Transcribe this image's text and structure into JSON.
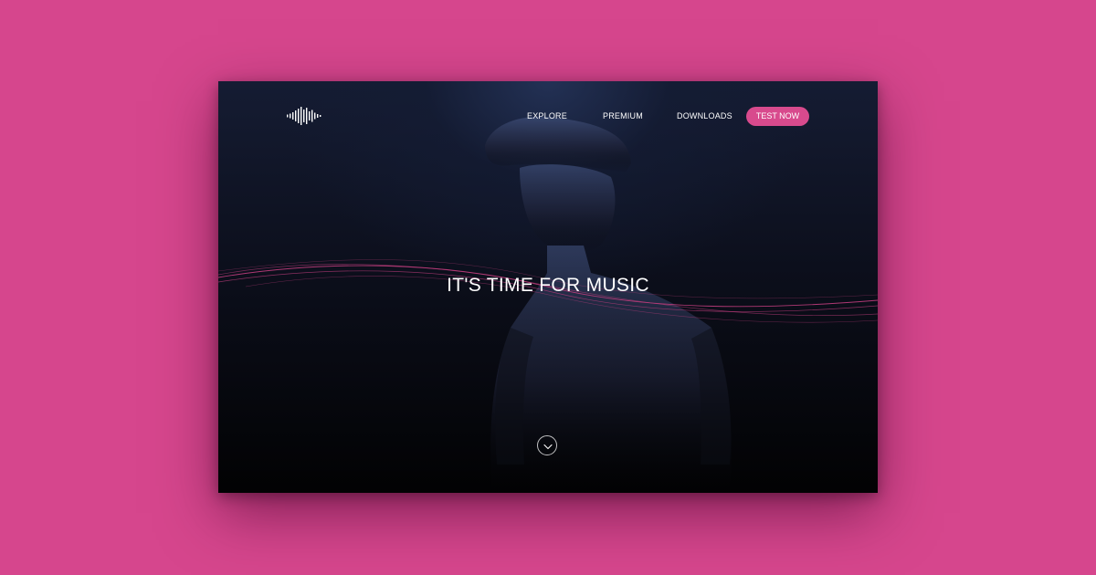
{
  "colors": {
    "page_background": "#d6468d",
    "hero_top": "#233155",
    "hero_bottom": "#020203",
    "accent": "#d84a8d",
    "text": "#ffffff",
    "wave_line": "#c03d7d"
  },
  "header": {
    "logo_icon": "sound-wave-icon",
    "nav": [
      {
        "label": "EXPLORE"
      },
      {
        "label": "PREMIUM"
      },
      {
        "label": "DOWNLOADS"
      }
    ],
    "cta_label": "TEST NOW"
  },
  "hero": {
    "headline": "IT'S TIME FOR MUSIC",
    "scroll_icon": "chevron-down-icon"
  }
}
